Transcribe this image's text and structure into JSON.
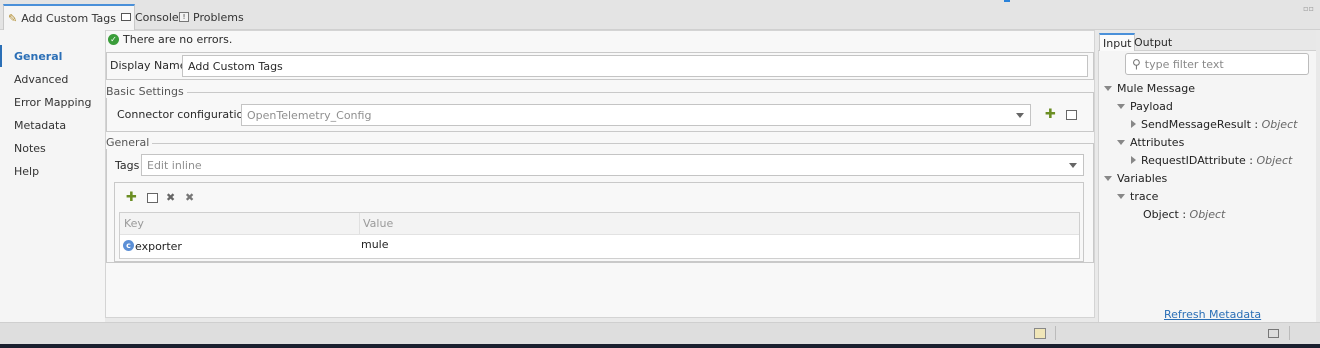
{
  "tabs": [
    {
      "label": "Add Custom Tags",
      "icon": "edit-pencil-icon",
      "active": true
    },
    {
      "label": "Console",
      "icon": "console-icon"
    },
    {
      "label": "Problems",
      "icon": "problems-icon"
    }
  ],
  "nav": {
    "items": [
      "General",
      "Advanced",
      "Error Mapping",
      "Metadata",
      "Notes",
      "Help"
    ],
    "active": "General"
  },
  "status": {
    "message": "There are no errors."
  },
  "display_name": {
    "label": "Display Name:",
    "value": "Add Custom Tags"
  },
  "basic_settings": {
    "title": "Basic Settings",
    "connector_label": "Connector configuration:",
    "connector_value": "OpenTelemetry_Config"
  },
  "general": {
    "title": "General",
    "tags_label": "Tags",
    "tags_mode": "Edit inline",
    "table": {
      "columns": [
        "Key",
        "Value"
      ],
      "rows": [
        {
          "key": "exporter",
          "value": "mule"
        }
      ]
    }
  },
  "right_panel": {
    "tabs": [
      "Input",
      "Output"
    ],
    "active_tab": "Input",
    "filter_placeholder": "type filter text",
    "tree": {
      "mule_message": "Mule Message",
      "payload": "Payload",
      "payload_child": "SendMessageResult",
      "payload_child_type": "Object",
      "attributes": "Attributes",
      "attributes_child": "RequestIDAttribute",
      "attributes_child_type": "Object",
      "variables": "Variables",
      "trace": "trace",
      "trace_child": "Object",
      "trace_child_type": "Object"
    },
    "refresh_link": "Refresh Metadata"
  },
  "colors": {
    "accent": "#2b6fb6",
    "ok": "#3a9d3a"
  }
}
